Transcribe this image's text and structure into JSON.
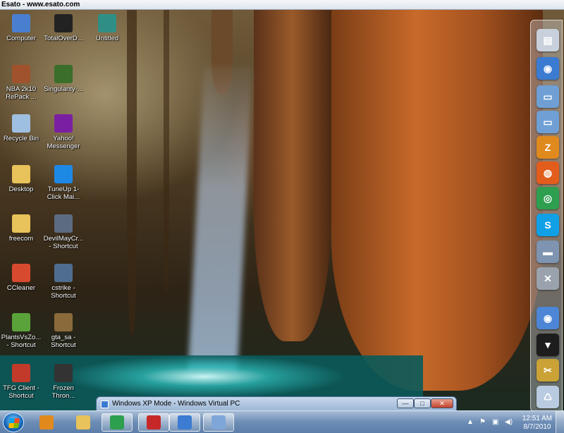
{
  "titlebar": {
    "text": "Esato - www.esato.com"
  },
  "desktop": {
    "icons": [
      {
        "label": "Computer",
        "icon": "computer-icon",
        "color": "#4a7fd0"
      },
      {
        "label": "TotalOverD...",
        "icon": "app-icon",
        "color": "#222222"
      },
      {
        "label": "Untitled",
        "icon": "image-icon",
        "color": "#2f8f86"
      },
      {
        "label": "NBA 2k10 RePack ...",
        "icon": "game-icon",
        "color": "#a0522d"
      },
      {
        "label": "Singularity-...",
        "icon": "game-icon",
        "color": "#3a6e2a"
      },
      {
        "label": "Recycle Bin",
        "icon": "recycle-bin-icon",
        "color": "#9fbfe0"
      },
      {
        "label": "Yahoo! Messenger",
        "icon": "messenger-icon",
        "color": "#7b1fa2"
      },
      {
        "label": "Desktop",
        "icon": "folder-icon",
        "color": "#e8c25a"
      },
      {
        "label": "TuneUp 1-Click Mai...",
        "icon": "tuneup-icon",
        "color": "#1e88e5"
      },
      {
        "label": "freecom",
        "icon": "folder-icon",
        "color": "#e8c25a"
      },
      {
        "label": "DevilMayCr... - Shortcut",
        "icon": "game-icon",
        "color": "#5c6b80"
      },
      {
        "label": "CCleaner",
        "icon": "ccleaner-icon",
        "color": "#d84a2f"
      },
      {
        "label": "cstrike - Shortcut",
        "icon": "game-icon",
        "color": "#4f6e8f"
      },
      {
        "label": "PlantsVsZo... - Shortcut",
        "icon": "game-icon",
        "color": "#5aa33a"
      },
      {
        "label": "gta_sa - Shortcut",
        "icon": "game-icon",
        "color": "#8a6a3a"
      },
      {
        "label": "TFG Client - Shortcut",
        "icon": "app-icon",
        "color": "#c23a2a"
      },
      {
        "label": "Frozen Thron...",
        "icon": "game-icon",
        "color": "#333333"
      }
    ]
  },
  "dock": {
    "items": [
      {
        "icon": "notepad-icon",
        "color": "#c8d0dc",
        "glyph": "▤"
      },
      {
        "icon": "globe-icon",
        "color": "#3b7bd1",
        "glyph": "◉"
      },
      {
        "icon": "folder-icon",
        "color": "#6f9fd4",
        "glyph": "▭"
      },
      {
        "icon": "folder-icon",
        "color": "#6f9fd4",
        "glyph": "▭"
      },
      {
        "icon": "winzip-icon",
        "color": "#e08a1e",
        "glyph": "Z"
      },
      {
        "icon": "firefox-icon",
        "color": "#e25d1c",
        "glyph": "◍"
      },
      {
        "icon": "chrome-icon",
        "color": "#2e9e4f",
        "glyph": "◎"
      },
      {
        "icon": "skype-icon",
        "color": "#11a0e6",
        "glyph": "S"
      },
      {
        "icon": "drive-icon",
        "color": "#7e94b0",
        "glyph": "▬"
      },
      {
        "icon": "tools-icon",
        "color": "#9aa3ad",
        "glyph": "✕"
      },
      {
        "icon": "network-globe-icon",
        "color": "#4d86d6",
        "glyph": "◉"
      },
      {
        "icon": "shirt-icon",
        "color": "#1d1d1d",
        "glyph": "▼"
      },
      {
        "icon": "wrench-icon",
        "color": "#caa236",
        "glyph": "✂"
      },
      {
        "icon": "recycle-bin-icon",
        "color": "#b9cbe0",
        "glyph": "♺"
      }
    ]
  },
  "vpc_window": {
    "title": "Windows XP Mode - Windows Virtual PC"
  },
  "taskbar": {
    "apps": [
      {
        "icon": "media-player-icon",
        "color": "#e08a1e",
        "active": false
      },
      {
        "icon": "explorer-icon",
        "color": "#e8c25a",
        "active": false
      },
      {
        "icon": "chrome-icon",
        "color": "#2e9e4f",
        "active": true
      },
      {
        "icon": "antivirus-icon",
        "color": "#c62828",
        "active": true
      },
      {
        "icon": "virtual-pc-icon",
        "color": "#3b7bd1",
        "active": true
      },
      {
        "icon": "control-panel-icon",
        "color": "#7ea7d8",
        "active": true
      }
    ]
  },
  "tray": {
    "time": "12:51 AM",
    "date": "8/7/2010"
  }
}
